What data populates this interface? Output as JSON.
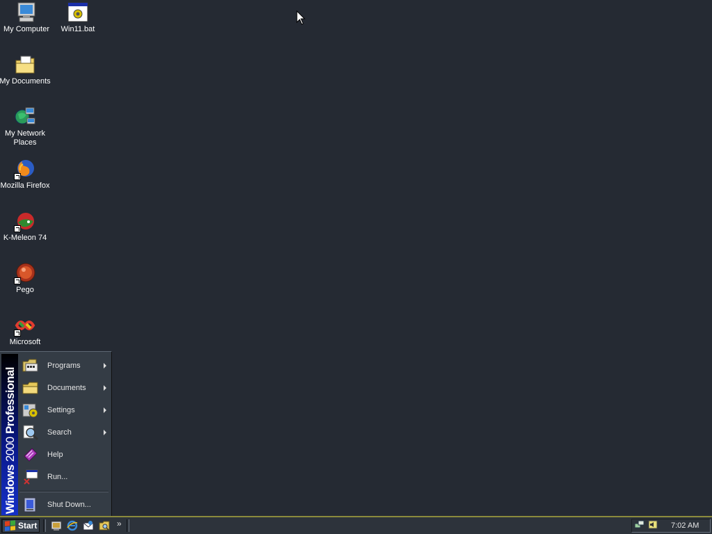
{
  "desktop": {
    "icons": [
      {
        "label": "My Computer",
        "icon": "my-computer-icon"
      },
      {
        "label": "Win11.bat",
        "icon": "batch-file-icon"
      },
      {
        "label": "My Documents",
        "icon": "my-documents-icon"
      },
      {
        "label": "My Network Places",
        "icon": "network-places-icon"
      },
      {
        "label": "Mozilla Firefox",
        "icon": "firefox-icon"
      },
      {
        "label": "K-Meleon 74",
        "icon": "k-meleon-icon"
      },
      {
        "label": "Pego",
        "icon": "pego-icon"
      },
      {
        "label": "Microsoft",
        "icon": "visual-studio-icon"
      }
    ]
  },
  "start_menu": {
    "banner_bold": "Windows",
    "banner_version": "2000",
    "banner_edition": "Professional",
    "items": [
      {
        "label": "Programs",
        "icon": "programs-icon",
        "submenu": true
      },
      {
        "label": "Documents",
        "icon": "documents-icon",
        "submenu": true
      },
      {
        "label": "Settings",
        "icon": "settings-icon",
        "submenu": true
      },
      {
        "label": "Search",
        "icon": "search-icon",
        "submenu": true
      },
      {
        "label": "Help",
        "icon": "help-icon",
        "submenu": false
      },
      {
        "label": "Run...",
        "icon": "run-icon",
        "submenu": false
      },
      {
        "label": "Shut Down...",
        "icon": "shutdown-icon",
        "submenu": false
      }
    ]
  },
  "taskbar": {
    "start_label": "Start",
    "quick_launch": [
      "show-desktop-icon",
      "internet-explorer-icon",
      "outlook-express-icon",
      "explorer-icon"
    ],
    "chevron": "»",
    "clock": "7:02 AM",
    "tray_icons": [
      "network-tray-icon",
      "volume-tray-icon"
    ]
  },
  "colors": {
    "desktop": "#252a33",
    "banner_blue": "#1530c8",
    "taskbar": "#2d333b"
  }
}
